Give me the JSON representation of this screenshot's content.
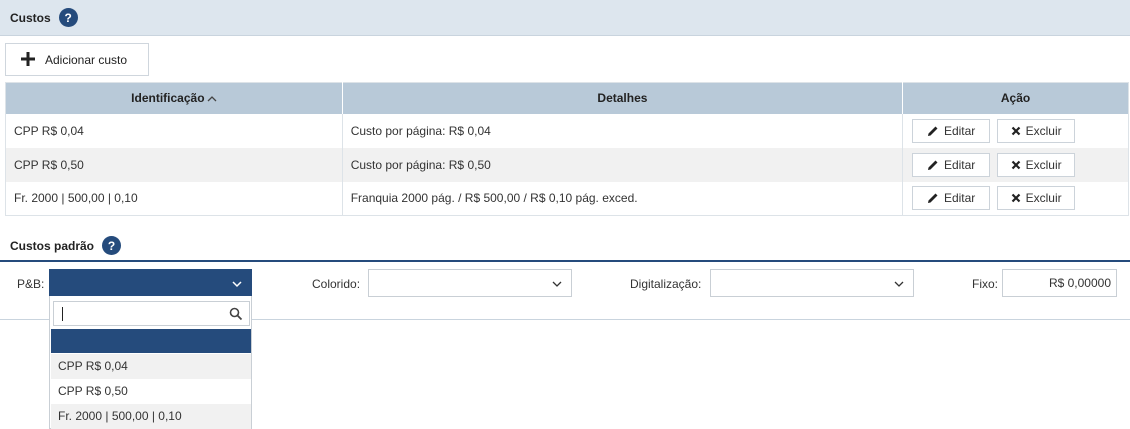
{
  "custos": {
    "title": "Custos",
    "help": "?",
    "add_button_label": "Adicionar custo",
    "table": {
      "headers": {
        "identificacao": "Identificação",
        "detalhes": "Detalhes",
        "acao": "Ação"
      },
      "rows": [
        {
          "id": "CPP R$ 0,04",
          "detalhes": "Custo por página: R$ 0,04"
        },
        {
          "id": "CPP R$ 0,50",
          "detalhes": "Custo por página: R$ 0,50"
        },
        {
          "id": "Fr. 2000 | 500,00 | 0,10",
          "detalhes": "Franquia 2000 pág. / R$ 500,00 / R$ 0,10 pág. exced."
        }
      ],
      "edit_label": "Editar",
      "delete_label": "Excluir"
    }
  },
  "custos_padrao": {
    "title": "Custos padrão",
    "help": "?",
    "pb_label": "P&B:",
    "colorido_label": "Colorido:",
    "digitalizacao_label": "Digitalização:",
    "fixo_label": "Fixo:",
    "fixo_value": "R$ 0,00000",
    "dropdown_options": [
      "CPP R$ 0,04",
      "CPP R$ 0,50",
      "Fr. 2000 | 500,00 | 0,10"
    ]
  },
  "colors": {
    "accent": "#254b7c",
    "header_bg": "#dde6ee",
    "table_header_bg": "#b8c9d8"
  }
}
